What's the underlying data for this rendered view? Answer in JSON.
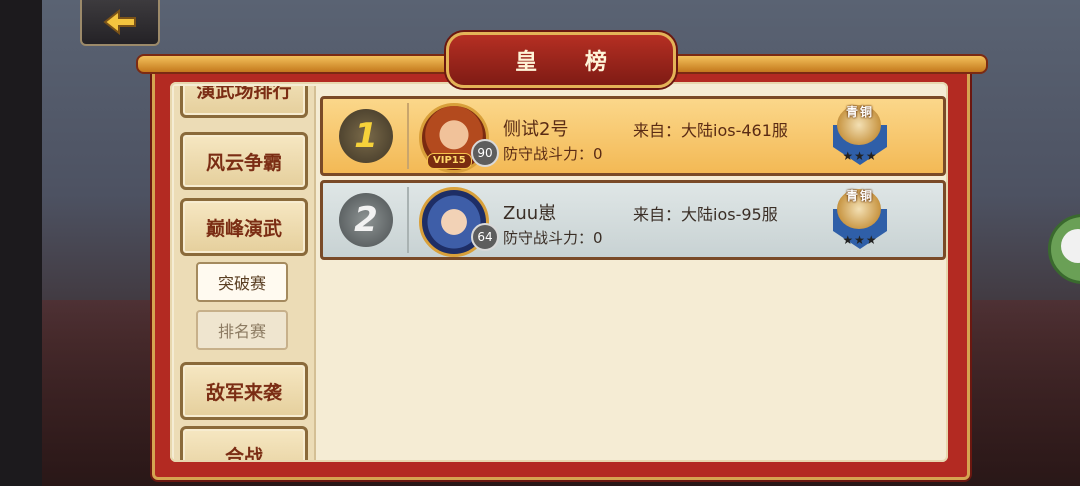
{
  "header": {
    "title": "皇 榜"
  },
  "sidebar": {
    "items": [
      {
        "label": "演武场排行"
      },
      {
        "label": "风云争霸"
      },
      {
        "label": "巅峰演武"
      },
      {
        "label": "突破赛"
      },
      {
        "label": "排名赛"
      },
      {
        "label": "敌军来袭"
      },
      {
        "label": "合战"
      }
    ]
  },
  "rankings": [
    {
      "rank": "1",
      "name": "侧试2号",
      "level": "90",
      "vip": "VIP15",
      "server": "来自：大陆ios-461服",
      "power": "防守战斗力：0",
      "tier": "青铜",
      "stars": "★★★"
    },
    {
      "rank": "2",
      "name": "Zuu崽",
      "level": "64",
      "vip": "",
      "server": "来自：大陆ios-95服",
      "power": "防守战斗力：0",
      "tier": "青铜",
      "stars": "★★★"
    }
  ],
  "colors": {
    "frame": "#b32a22",
    "gold_row": "#f3b955",
    "silver_row": "#c8d2d3"
  },
  "icons": {
    "back": "back-arrow-icon",
    "panda": "panda-avatar-icon"
  }
}
